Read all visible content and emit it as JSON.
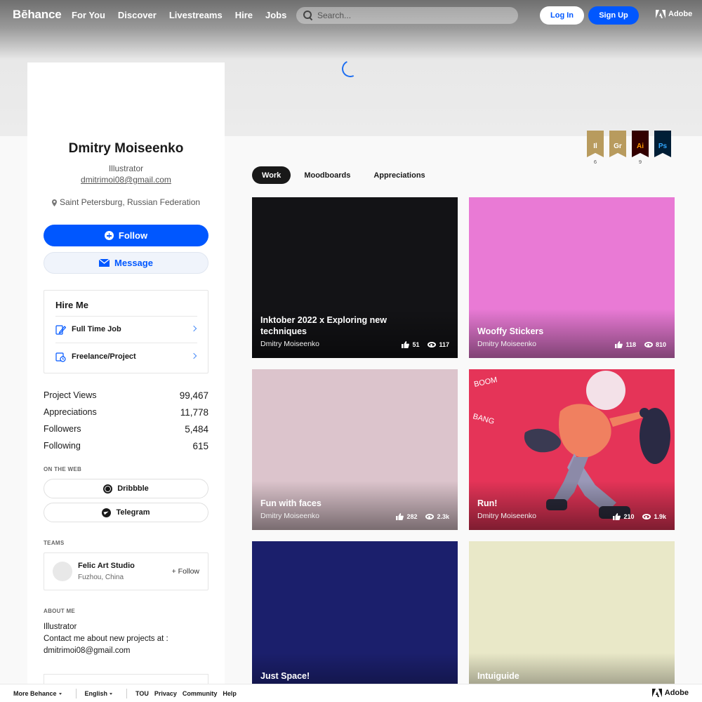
{
  "nav": {
    "logo": "Bēhance",
    "links": [
      "For You",
      "Discover",
      "Livestreams",
      "Hire",
      "Jobs"
    ],
    "search_placeholder": "Search...",
    "login_label": "Log In",
    "signup_label": "Sign Up",
    "adobe_label": "Adobe"
  },
  "profile": {
    "name": "Dmitry Moiseenko",
    "occupation": "Illustrator",
    "email": "dmitrimoi08@gmail.com",
    "location": "Saint Petersburg, Russian Federation",
    "follow_label": "Follow",
    "message_label": "Message"
  },
  "hire": {
    "title": "Hire Me",
    "options": [
      {
        "label": "Full Time Job",
        "icon": "contract-pen-icon"
      },
      {
        "label": "Freelance/Project",
        "icon": "project-clock-icon"
      }
    ]
  },
  "stats": [
    {
      "label": "Project Views",
      "value": "99,467"
    },
    {
      "label": "Appreciations",
      "value": "11,778"
    },
    {
      "label": "Followers",
      "value": "5,484"
    },
    {
      "label": "Following",
      "value": "615"
    }
  ],
  "on_the_web": {
    "label": "ON THE WEB",
    "links": [
      {
        "label": "Dribbble",
        "icon": "dribbble-icon"
      },
      {
        "label": "Telegram",
        "icon": "telegram-icon"
      }
    ]
  },
  "teams": {
    "label": "TEAMS",
    "items": [
      {
        "name": "Felic Art Studio",
        "location": "Fuzhou, China",
        "follow_label": "+ Follow"
      }
    ]
  },
  "about": {
    "label": "ABOUT ME",
    "lines": [
      "Illustrator",
      "Contact me about new projects at :",
      "dmitrimoi08@gmail.com"
    ]
  },
  "badges": [
    {
      "abbr": "Il",
      "count": "6",
      "bg": "#b89b5e",
      "fg": "#ffffff"
    },
    {
      "abbr": "Gr",
      "count": "",
      "bg": "#b89b5e",
      "fg": "#ffffff"
    },
    {
      "abbr": "Ai",
      "count": "9",
      "bg": "#330000",
      "fg": "#ff9a00"
    },
    {
      "abbr": "Ps",
      "count": "",
      "bg": "#001e36",
      "fg": "#31a8ff"
    }
  ],
  "tabs": [
    {
      "label": "Work",
      "active": true
    },
    {
      "label": "Moodboards",
      "active": false
    },
    {
      "label": "Appreciations",
      "active": false
    }
  ],
  "projects": [
    {
      "title": "Inktober 2022 x Exploring new techniques",
      "owner": "Dmitry Moiseenko",
      "likes": "51",
      "views": "117",
      "color": "#131316"
    },
    {
      "title": "Wooffy Stickers",
      "owner": "Dmitry Moiseenko",
      "likes": "118",
      "views": "810",
      "color": "#e97ad5"
    },
    {
      "title": "Fun with faces",
      "owner": "Dmitry Moiseenko",
      "likes": "282",
      "views": "2.3k",
      "color": "#dcc4cc"
    },
    {
      "title": "Run!",
      "owner": "Dmitry Moiseenko",
      "likes": "210",
      "views": "1.9k",
      "color": "#e53458"
    },
    {
      "title": "Just Space!",
      "owner": "",
      "likes": "",
      "views": "",
      "color": "#1b1f6c"
    },
    {
      "title": "Intuiguide",
      "owner": "",
      "likes": "",
      "views": "",
      "color": "#e9e8c8"
    }
  ],
  "footer": {
    "more_behance": "More Behance",
    "language": "English",
    "links": [
      "TOU",
      "Privacy",
      "Community",
      "Help"
    ],
    "adobe_label": "Adobe"
  },
  "colors": {
    "brand_blue": "#0057ff",
    "text": "#191919"
  }
}
